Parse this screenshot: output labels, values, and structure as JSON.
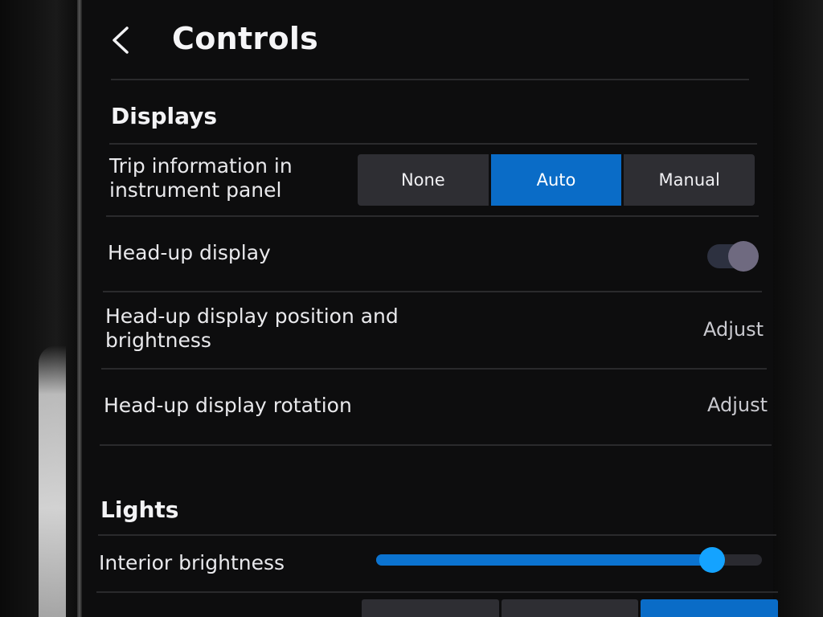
{
  "header": {
    "title": "Controls",
    "back_icon": "chevron-left-icon"
  },
  "displays": {
    "title": "Displays",
    "trip_info": {
      "label_line1": "Trip information in",
      "label_line2": "instrument panel",
      "options": [
        "None",
        "Auto",
        "Manual"
      ],
      "selected": "Auto"
    },
    "hud": {
      "label": "Head-up display",
      "toggle_on": true
    },
    "hud_position": {
      "label_line1": "Head-up display position and",
      "label_line2": "brightness",
      "action": "Adjust"
    },
    "hud_rotation": {
      "label": "Head-up display rotation",
      "action": "Adjust"
    }
  },
  "lights": {
    "title": "Lights",
    "interior_brightness": {
      "label": "Interior brightness",
      "value_percent": 87
    }
  },
  "colors": {
    "accent": "#0a6cc7",
    "slider_thumb": "#14a3ff",
    "background": "#0d0d0e"
  }
}
